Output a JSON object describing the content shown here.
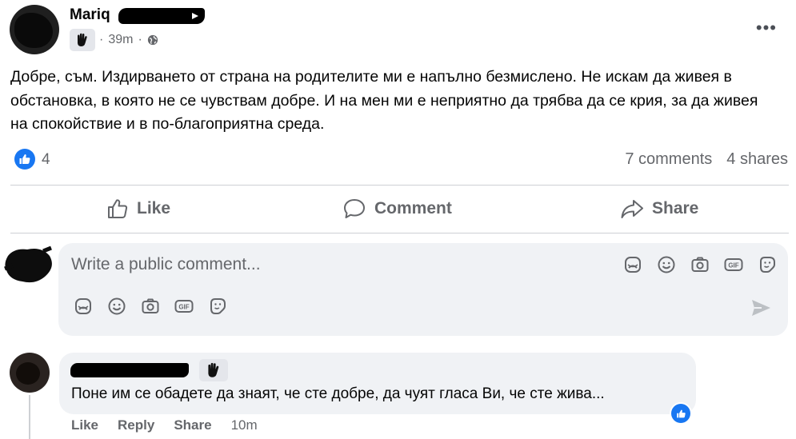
{
  "post": {
    "author": "Mariq",
    "time": "39m",
    "separator": "·",
    "text": "Добре, съм. Издирването от страна на родителите ми е напълно безмислено. Не искам да живея в обстановка, в която не се чувствам добре. И на мен ми е неприятно да трябва да се крия, за да живея на спокойствие и в по-благоприятна среда.",
    "like_count": "4",
    "comments": "7 comments",
    "shares": "4 shares"
  },
  "actions": {
    "like": "Like",
    "comment": "Comment",
    "share": "Share"
  },
  "composer": {
    "placeholder": "Write a public comment..."
  },
  "comment": {
    "text": "Поне им се обадете да знаят, че сте добре, да чуят гласа Ви, че сте жива...",
    "like": "Like",
    "reply": "Reply",
    "share": "Share",
    "time": "10m"
  },
  "colors": {
    "accent": "#1877f2",
    "secondary_text": "#65676b",
    "bubble": "#f0f2f5"
  },
  "icons": [
    "wave-badge-icon",
    "globe-icon",
    "more-icon",
    "like-icon",
    "comment-icon",
    "share-icon",
    "sticker-icon",
    "emoji-icon",
    "camera-icon",
    "gif-icon",
    "avatar-sticker-icon",
    "send-icon"
  ]
}
